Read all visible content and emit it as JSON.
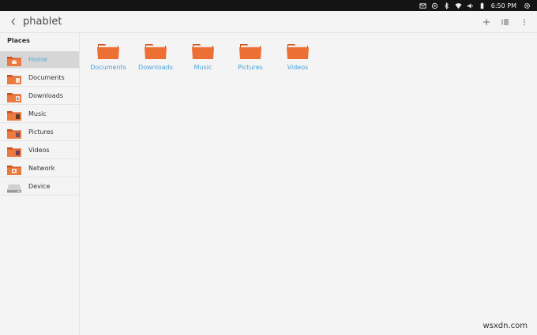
{
  "status_bar": {
    "time": "6:50 PM",
    "icons": [
      "mail-icon",
      "location-icon",
      "bluetooth-icon",
      "wifi-icon",
      "volume-icon",
      "battery-icon",
      "settings-icon"
    ]
  },
  "header": {
    "title": "phablet",
    "back_icon": "back-chevron-icon",
    "actions": [
      "add-icon",
      "list-view-icon",
      "overflow-menu-icon"
    ]
  },
  "sidebar": {
    "section_title": "Places",
    "items": [
      {
        "label": "Home",
        "icon": "home-folder-icon",
        "active": true
      },
      {
        "label": "Documents",
        "icon": "documents-folder-icon",
        "active": false
      },
      {
        "label": "Downloads",
        "icon": "downloads-folder-icon",
        "active": false
      },
      {
        "label": "Music",
        "icon": "music-folder-icon",
        "active": false
      },
      {
        "label": "Pictures",
        "icon": "pictures-folder-icon",
        "active": false
      },
      {
        "label": "Videos",
        "icon": "videos-folder-icon",
        "active": false
      },
      {
        "label": "Network",
        "icon": "network-icon",
        "active": false
      },
      {
        "label": "Device",
        "icon": "drive-icon",
        "active": false
      }
    ]
  },
  "main": {
    "folders": [
      {
        "label": "Documents"
      },
      {
        "label": "Downloads"
      },
      {
        "label": "Music"
      },
      {
        "label": "Pictures"
      },
      {
        "label": "Videos"
      }
    ]
  },
  "watermark": "wsxdn.com",
  "colors": {
    "folder_orange": "#e8662a",
    "link_blue": "#4aa3d8",
    "active_bg": "#d6d6d6"
  }
}
